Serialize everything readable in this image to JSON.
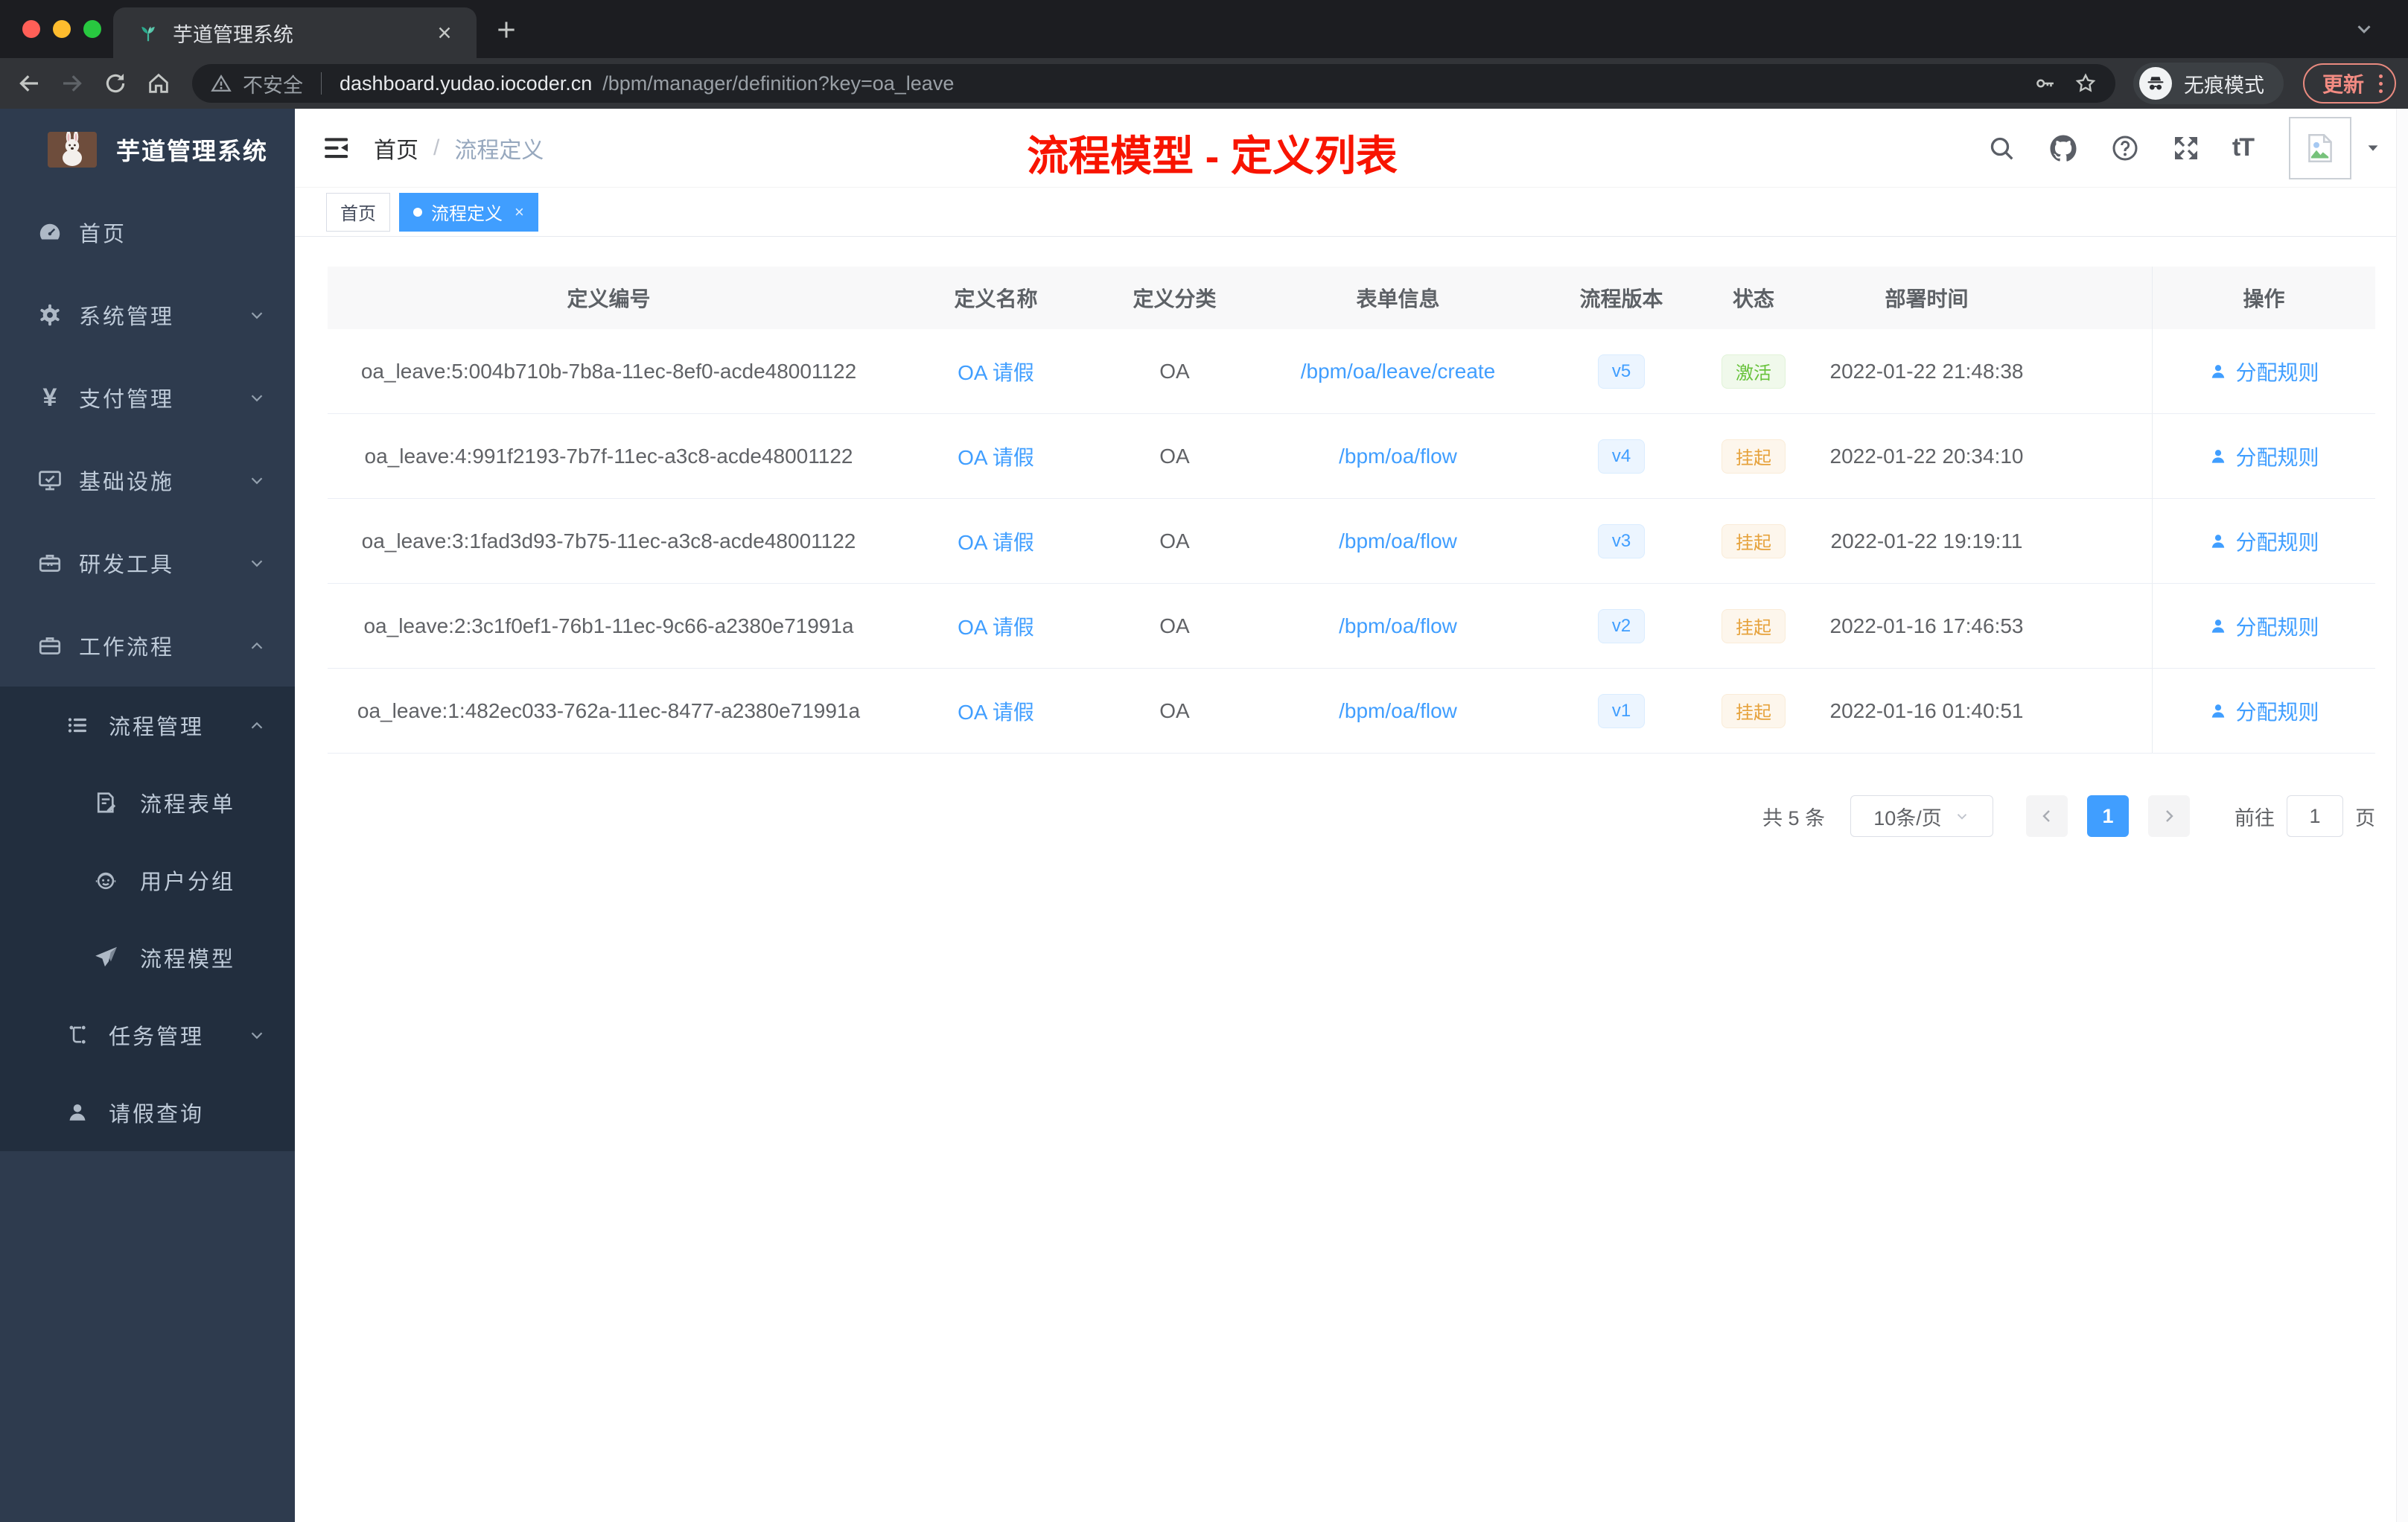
{
  "colors": {
    "accent": "#409eff",
    "success": "#67c23a",
    "warning": "#e6a23c",
    "annotation_red": "#f81400",
    "sidebar_bg": "#2e3b4e",
    "submenu_bg": "#222e3e"
  },
  "browser": {
    "tab_title": "芋道管理系统",
    "security_label": "不安全",
    "url_domain": "dashboard.yudao.iocoder.cn",
    "url_path": "/bpm/manager/definition?key=oa_leave",
    "incognito_label": "无痕模式",
    "update_label": "更新"
  },
  "sidebar": {
    "brand": "芋道管理系统",
    "items": [
      {
        "label": "首页",
        "icon": "dashboard-icon"
      },
      {
        "label": "系统管理",
        "icon": "gear-icon"
      },
      {
        "label": "支付管理",
        "icon": "yen-icon"
      },
      {
        "label": "基础设施",
        "icon": "monitor-icon"
      },
      {
        "label": "研发工具",
        "icon": "toolbox-icon"
      },
      {
        "label": "工作流程",
        "icon": "briefcase-icon"
      },
      {
        "label": "流程管理",
        "icon": "list-icon"
      },
      {
        "label": "流程表单",
        "icon": "form-icon"
      },
      {
        "label": "用户分组",
        "icon": "user-group-icon"
      },
      {
        "label": "流程模型",
        "icon": "paper-plane-icon"
      },
      {
        "label": "任务管理",
        "icon": "tree-icon"
      },
      {
        "label": "请假查询",
        "icon": "person-icon"
      }
    ]
  },
  "header": {
    "breadcrumb_home": "首页",
    "breadcrumb_current": "流程定义",
    "annotation": "流程模型 - 定义列表"
  },
  "tags": {
    "home": "首页",
    "active": "流程定义"
  },
  "table": {
    "columns": [
      "定义编号",
      "定义名称",
      "定义分类",
      "表单信息",
      "流程版本",
      "状态",
      "部署时间",
      "操作"
    ],
    "rows": [
      {
        "id": "oa_leave:5:004b710b-7b8a-11ec-8ef0-acde48001122",
        "name": "OA 请假",
        "category": "OA",
        "form": "/bpm/oa/leave/create",
        "version": "v5",
        "status": "激活",
        "status_type": "success",
        "deploy_time": "2022-01-22 21:48:38",
        "action": "分配规则"
      },
      {
        "id": "oa_leave:4:991f2193-7b7f-11ec-a3c8-acde48001122",
        "name": "OA 请假",
        "category": "OA",
        "form": "/bpm/oa/flow",
        "version": "v4",
        "status": "挂起",
        "status_type": "warning",
        "deploy_time": "2022-01-22 20:34:10",
        "action": "分配规则"
      },
      {
        "id": "oa_leave:3:1fad3d93-7b75-11ec-a3c8-acde48001122",
        "name": "OA 请假",
        "category": "OA",
        "form": "/bpm/oa/flow",
        "version": "v3",
        "status": "挂起",
        "status_type": "warning",
        "deploy_time": "2022-01-22 19:19:11",
        "action": "分配规则"
      },
      {
        "id": "oa_leave:2:3c1f0ef1-76b1-11ec-9c66-a2380e71991a",
        "name": "OA 请假",
        "category": "OA",
        "form": "/bpm/oa/flow",
        "version": "v2",
        "status": "挂起",
        "status_type": "warning",
        "deploy_time": "2022-01-16 17:46:53",
        "action": "分配规则"
      },
      {
        "id": "oa_leave:1:482ec033-762a-11ec-8477-a2380e71991a",
        "name": "OA 请假",
        "category": "OA",
        "form": "/bpm/oa/flow",
        "version": "v1",
        "status": "挂起",
        "status_type": "warning",
        "deploy_time": "2022-01-16 01:40:51",
        "action": "分配规则"
      }
    ]
  },
  "pagination": {
    "total": "共 5 条",
    "page_size": "10条/页",
    "current_page": "1",
    "goto_label": "前往",
    "goto_value": "1",
    "page_suffix": "页"
  }
}
